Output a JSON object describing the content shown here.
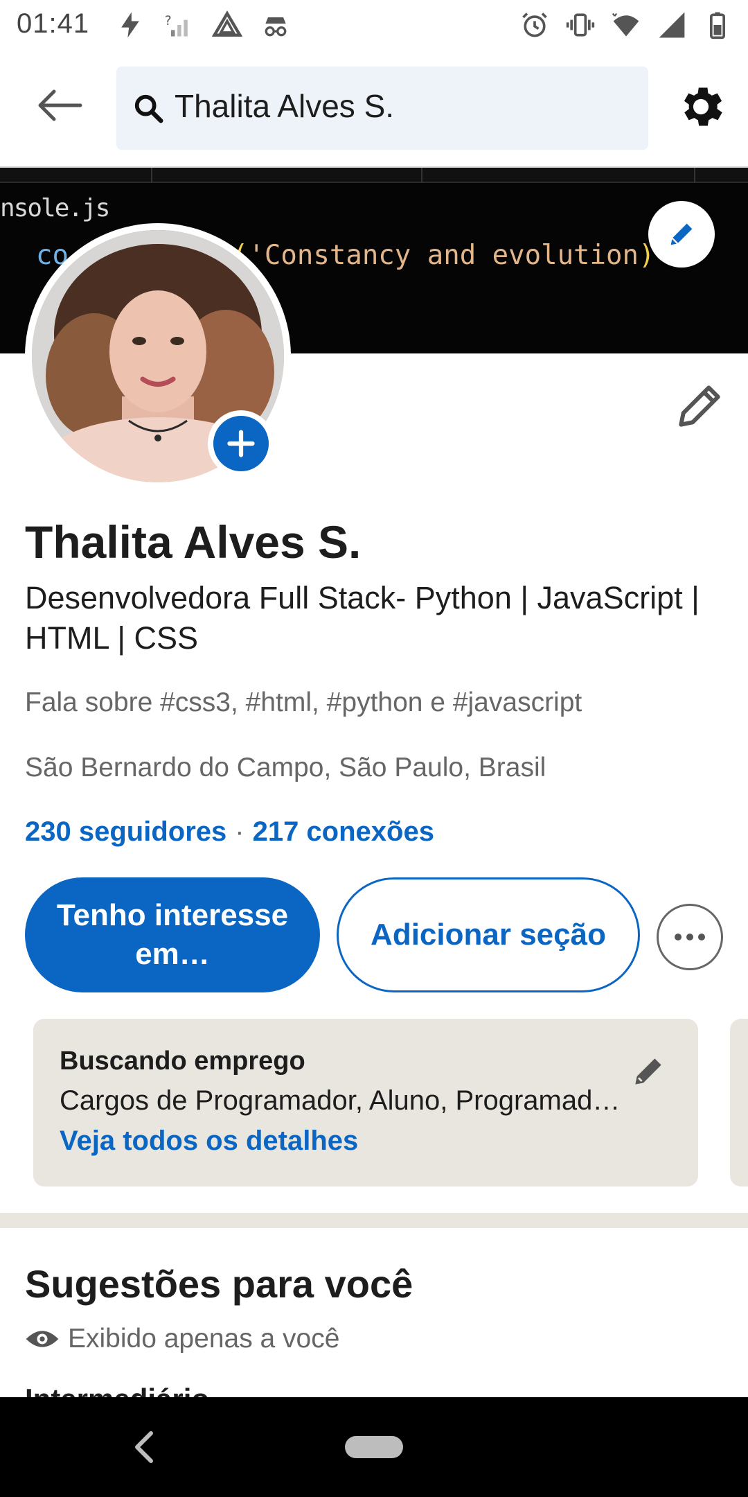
{
  "status_bar": {
    "time": "01:41",
    "left_icons": [
      "flash-icon",
      "no-signal-icon",
      "drive-icon",
      "incognito-icon"
    ],
    "right_icons": [
      "alarm-icon",
      "vibrate-icon",
      "wifi-icon",
      "signal-icon",
      "battery-icon"
    ]
  },
  "app_bar": {
    "search_value": "Thalita Alves S."
  },
  "cover": {
    "file_name": "nsole.js",
    "code_prefix": "co",
    "code_string": "'Constancy and evolution"
  },
  "profile": {
    "name": "Thalita Alves S.",
    "headline": "Desenvolvedora Full Stack- Python | JavaScript | HTML | CSS",
    "topics": "Fala sobre #css3, #html, #python e #javascript",
    "location": "São Bernardo do Campo, São Paulo, Brasil",
    "followers": "230 seguidores",
    "separator": "·",
    "connections": "217 conexões"
  },
  "actions": {
    "primary": "Tenho interesse em…",
    "secondary": "Adicionar seção"
  },
  "open_to_work": {
    "title": "Buscando emprego",
    "description": "Cargos de Programador, Aluno, Programador…",
    "link": "Veja todos os detalhes"
  },
  "suggestions": {
    "title": "Sugestões para você",
    "note": "Exibido apenas a você",
    "next_item": "Intermediário"
  },
  "colors": {
    "brand": "#0a66c2",
    "card_bg": "#e9e5df",
    "search_bg": "#edf3f8"
  }
}
